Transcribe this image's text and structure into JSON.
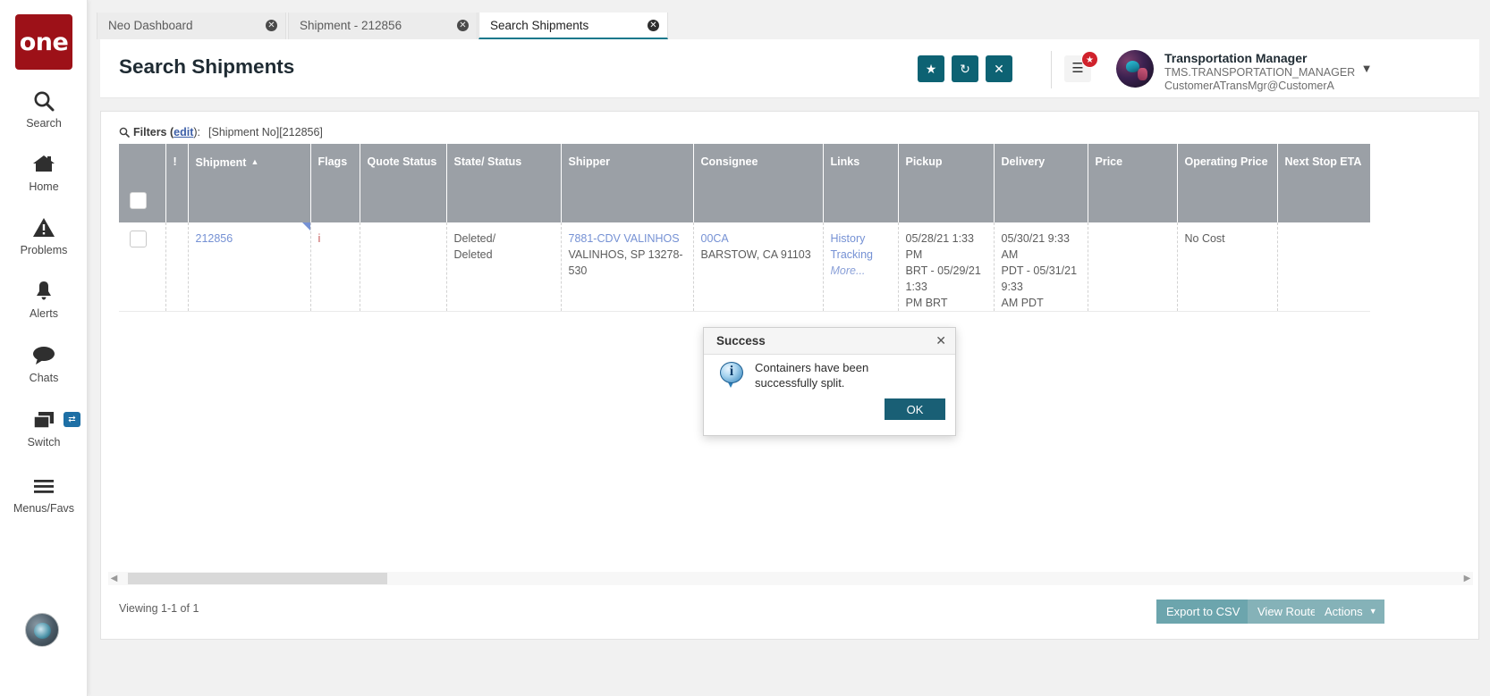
{
  "app": {
    "logo_text": "one"
  },
  "rail": {
    "items": [
      {
        "label": "Search",
        "icon": "search-icon"
      },
      {
        "label": "Home",
        "icon": "home-icon"
      },
      {
        "label": "Problems",
        "icon": "warning-icon"
      },
      {
        "label": "Alerts",
        "icon": "bell-icon"
      },
      {
        "label": "Chats",
        "icon": "chat-icon"
      },
      {
        "label": "Switch",
        "icon": "windows-icon"
      },
      {
        "label": "Menus/Favs",
        "icon": "hamburger-icon"
      }
    ],
    "switch_badge": "⇄"
  },
  "tabs": [
    {
      "label": "Neo Dashboard",
      "active": false,
      "close": "✕"
    },
    {
      "label": "Shipment - 212856",
      "active": false,
      "close": "✕"
    },
    {
      "label": "Search Shipments",
      "active": true,
      "close": "✕"
    }
  ],
  "header": {
    "title": "Search Shipments",
    "buttons": {
      "favorite": "★",
      "refresh": "↻",
      "close": "✕"
    },
    "menu_icon": "☰",
    "menu_badge": "★",
    "user_name": "Transportation Manager",
    "user_id": "TMS.TRANSPORTATION_MANAGER",
    "user_email": "CustomerATransMgr@CustomerA",
    "caret": "▼"
  },
  "filters": {
    "icon": "search-icon",
    "label": "Filters (",
    "edit_label": "edit",
    "label_end": "):",
    "value": "[Shipment No][212856]"
  },
  "grid": {
    "columns": [
      {
        "key": "check",
        "label": ""
      },
      {
        "key": "bang",
        "label": "!"
      },
      {
        "key": "shipment",
        "label": "Shipment",
        "sorted": "asc",
        "sort_arrow": "▲"
      },
      {
        "key": "flags",
        "label": "Flags"
      },
      {
        "key": "quote",
        "label": "Quote Status"
      },
      {
        "key": "state",
        "label": "State/ Status"
      },
      {
        "key": "shipper",
        "label": "Shipper"
      },
      {
        "key": "consignee",
        "label": "Consignee"
      },
      {
        "key": "links",
        "label": "Links"
      },
      {
        "key": "pickup",
        "label": "Pickup"
      },
      {
        "key": "delivery",
        "label": "Delivery"
      },
      {
        "key": "price",
        "label": "Price"
      },
      {
        "key": "opprice",
        "label": "Operating Price"
      },
      {
        "key": "nextstop",
        "label": "Next Stop ETA"
      }
    ],
    "rows": [
      {
        "shipment": "212856",
        "bang": "",
        "flags": "i",
        "quote": "",
        "state_line1": "Deleted/",
        "state_line2": "Deleted",
        "shipper_name": "7881-CDV VALINHOS",
        "shipper_addr": "VALINHOS, SP 13278-530",
        "links": [
          "History",
          "Tracking"
        ],
        "links_more": "More...",
        "pickup_line1": "05/28/21 1:33 PM",
        "pickup_line2": "BRT - 05/29/21 1:33",
        "pickup_line3": "PM BRT",
        "delivery_line1": "05/30/21 9:33 AM",
        "delivery_line2": "PDT - 05/31/21 9:33",
        "delivery_line3": "AM PDT",
        "consignee_name": "00CA",
        "consignee_addr": "BARSTOW, CA 91103",
        "price": "",
        "opprice": "No Cost",
        "nextstop": ""
      }
    ]
  },
  "footer": {
    "viewing": "Viewing 1-1 of 1",
    "export_label": "Export to CSV",
    "view_route_label": "View Route",
    "actions_label": "Actions",
    "actions_caret": "▼"
  },
  "modal": {
    "title": "Success",
    "close": "✕",
    "icon": "info-icon",
    "icon_glyph": "i",
    "message": "Containers have been successfully split.",
    "ok_label": "OK"
  },
  "colors": {
    "brand_red": "#9d1118",
    "teal_button": "#0d6273",
    "header_gray": "#9ba0a6",
    "link_blue": "#7591d4",
    "modal_button": "#195f75"
  }
}
